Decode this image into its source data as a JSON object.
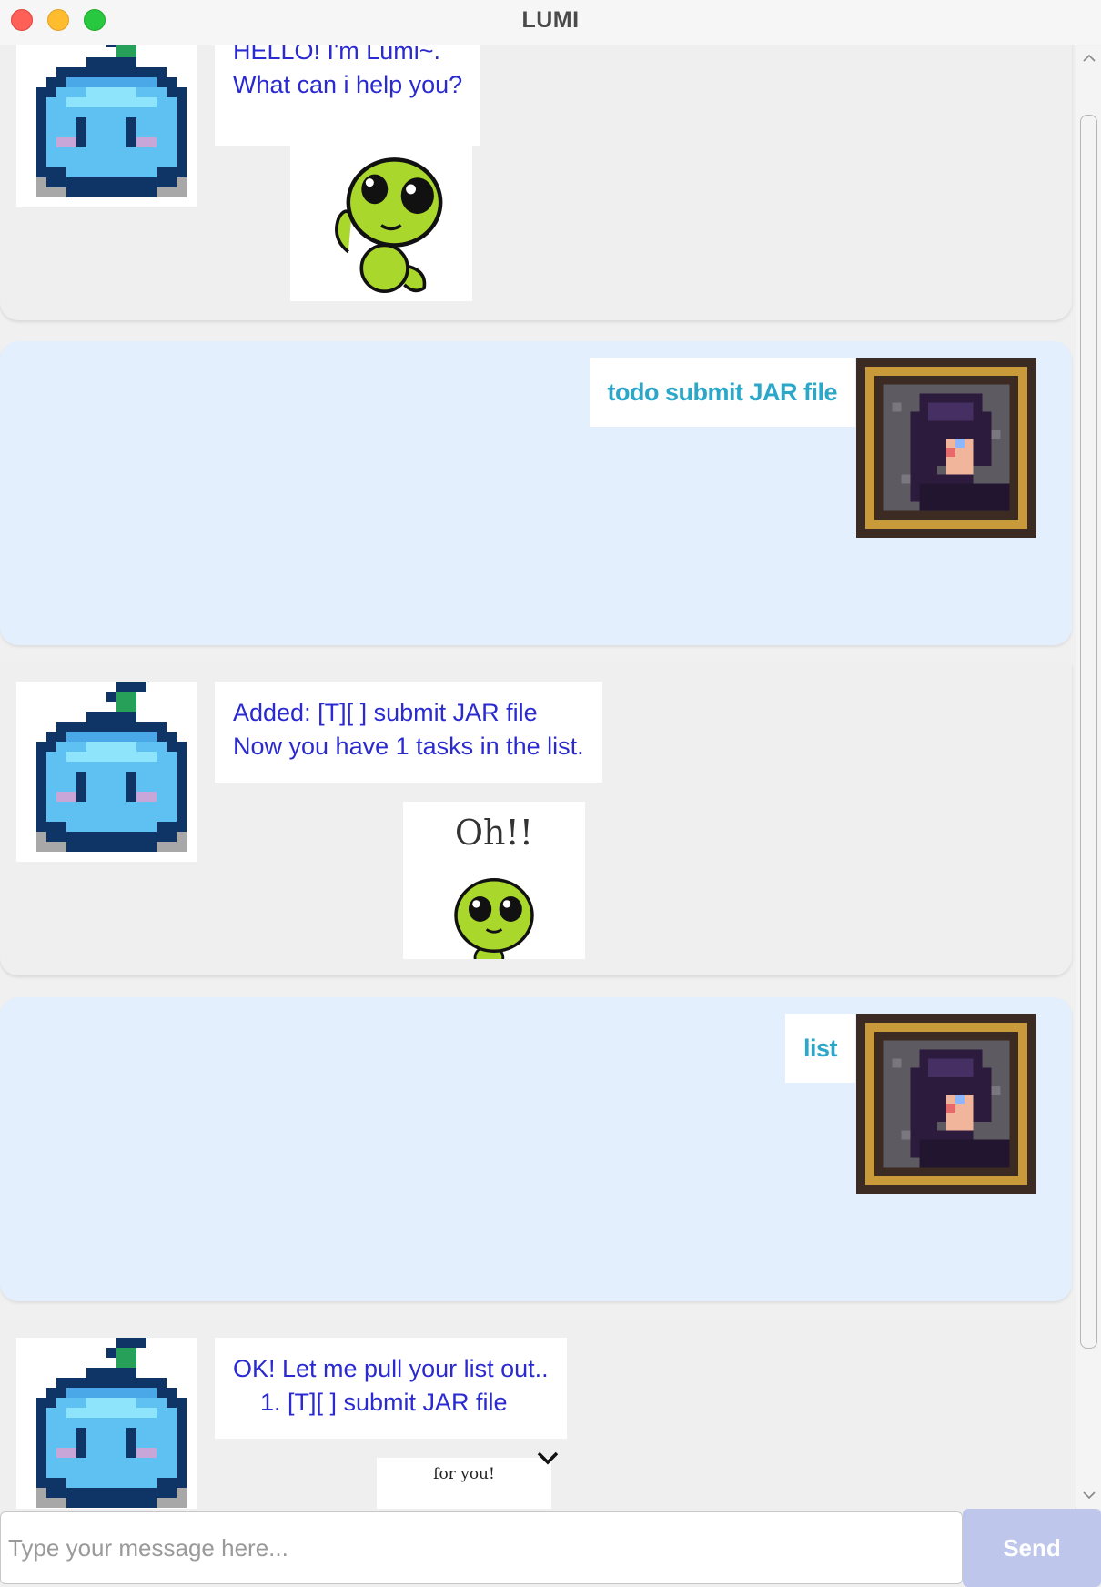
{
  "window": {
    "title": "LUMI"
  },
  "messages": [
    {
      "sender": "bot",
      "text": "HELLO! I'm Lumi~.\nWhat can i help you?"
    },
    {
      "sender": "user",
      "text": "todo submit JAR file"
    },
    {
      "sender": "bot",
      "text": "Added: [T][ ] submit JAR file\nNow you have 1 tasks in the list.",
      "sticker_text": "Oh!!"
    },
    {
      "sender": "user",
      "text": "list"
    },
    {
      "sender": "bot",
      "text": "OK! Let me pull your list out..\n    1. [T][ ] submit JAR file",
      "sticker_text": "for you!"
    }
  ],
  "input": {
    "placeholder": "Type your message here..."
  },
  "send": {
    "label": "Send"
  },
  "colors": {
    "bot_text": "#2a2ad0",
    "user_text": "#2aa7c9",
    "user_bg": "#e3effc",
    "bot_bg": "#efefef",
    "send_bg": "#bec7eb"
  },
  "icons": {
    "bot_avatar": "blue-apple-avatar",
    "user_avatar": "pixel-portrait-avatar",
    "sticker": "green-alien-sticker",
    "scroll_down": "chevron-down-icon"
  }
}
